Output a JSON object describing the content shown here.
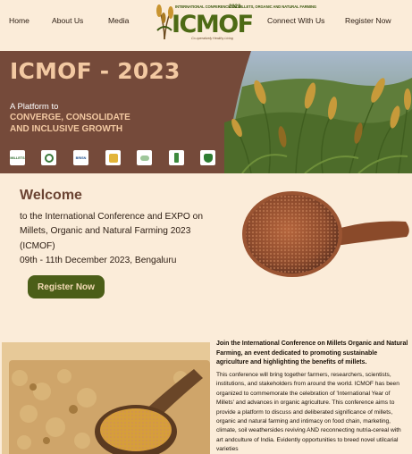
{
  "nav": {
    "links": [
      "Home",
      "About Us",
      "Media",
      "Connect With Us",
      "Register Now"
    ],
    "logo": {
      "top_line": "INTERNATIONAL CONFERENCE ON MILLETS, ORGANIC AND NATURAL FARMING",
      "year": "2023",
      "name": "ICMOF",
      "tagline": "Co-operatively Healthy Living"
    }
  },
  "hero": {
    "title": "ICMOF - 2023",
    "subtitle": "A Platform to",
    "line1": "CONVERGE, CONSOLIDATE",
    "line2": "AND INCLUSIVE GROWTH",
    "partners": [
      "MILLETS",
      "",
      "BRISN",
      "",
      "",
      "",
      ""
    ]
  },
  "welcome": {
    "heading": "Welcome",
    "text": "to the International Conference and EXPO on Millets, Organic and Natural Farming 2023 (ICMOF)",
    "date": "09th - 11th December 2023, Bengaluru",
    "button": "Register Now"
  },
  "about": {
    "heading": "Join the International Conference on Millets Organic and Natural Farming, an event dedicated to promoting sustainable agriculture and highlighting the benefits of millets.",
    "body": "This conference will bring together farmers, researchers, scientists, institutions, and stakeholders from around the world. ICMOF has been organized to commemorate the celebration of 'International Year of Millets' and advances in organic agriculture. This conference aims to provide a platform to discuss and deliberated significance of millets, organic and natural farming and intimacy on food chain, marketing, climate, soil weathersides reviving AND reconnecting nutria-cereal with art andculture of India. Evidently opportunities to breed novel utilcarial varieties"
  },
  "colors": {
    "background": "#fbecd9",
    "hero": "#754a3a",
    "accent": "#f3c9a2",
    "button": "#4b5e18"
  }
}
